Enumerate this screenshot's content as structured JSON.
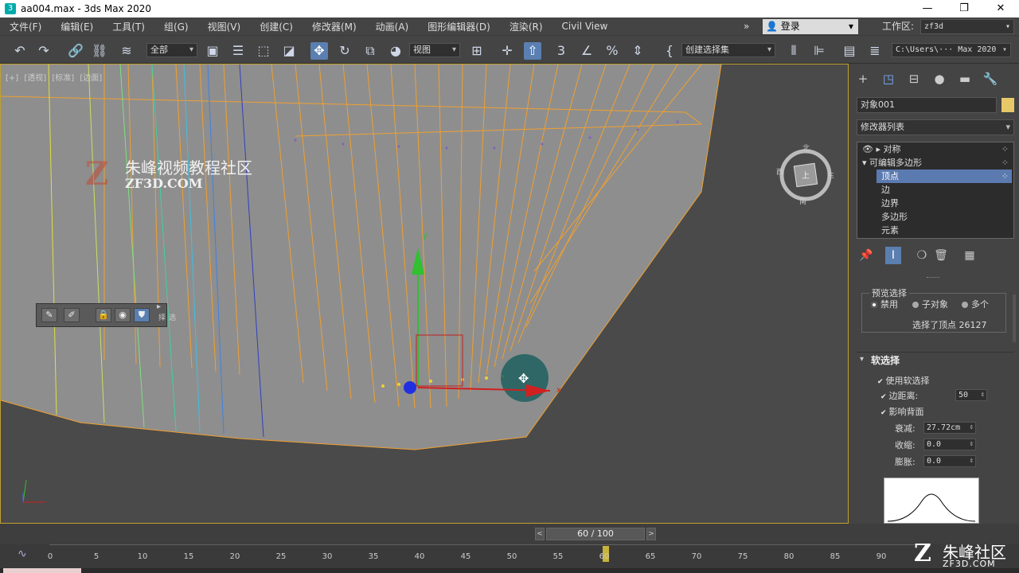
{
  "titlebar": {
    "app_icon": "3",
    "title": "aa004.max - 3ds Max 2020",
    "minimize": "—",
    "restore": "❐",
    "close": "✕"
  },
  "menubar": {
    "items": [
      "文件(F)",
      "编辑(E)",
      "工具(T)",
      "组(G)",
      "视图(V)",
      "创建(C)",
      "修改器(M)",
      "动画(A)",
      "图形编辑器(D)",
      "渲染(R)",
      "Civil View"
    ],
    "more": "»",
    "login": "登录",
    "workspace_label": "工作区:",
    "workspace_value": "zf3d"
  },
  "toolbar": {
    "selection_filter": "全部",
    "reference_coord": "视图",
    "named_selection": "创建选择集",
    "project_path": "C:\\Users\\··· Max 2020"
  },
  "viewport": {
    "label_plus": "[+]",
    "label_view": "[透视]",
    "label_shading1": "[标准]",
    "label_shading2": "[边面]",
    "watermark_cn": "朱峰视频教程社区",
    "watermark_en": "ZF3D.COM",
    "watermark_logo": "Z",
    "viewcube_n": "北",
    "viewcube_e": "东",
    "viewcube_s": "南",
    "viewcube_w": "西",
    "viewcube_face": "上",
    "gizmo_x": "x",
    "gizmo_y": "y"
  },
  "floating_toolbar": {
    "collapse": "▸",
    "side_label": "选择"
  },
  "command_panel": {
    "object_name": "对象001",
    "modifier_list": "修改器列表",
    "stack": [
      {
        "label": "对称",
        "type": "modifier"
      },
      {
        "label": "可编辑多边形",
        "type": "base"
      },
      {
        "label": "顶点",
        "type": "sub",
        "selected": true
      },
      {
        "label": "边",
        "type": "sub"
      },
      {
        "label": "边界",
        "type": "sub"
      },
      {
        "label": "多边形",
        "type": "sub"
      },
      {
        "label": "元素",
        "type": "sub"
      }
    ],
    "preview_selection": {
      "title": "预览选择",
      "options": [
        "禁用",
        "子对象",
        "多个"
      ],
      "selected": "禁用",
      "selection_text": "选择了顶点 26127"
    },
    "soft_selection": {
      "title": "软选择",
      "use_soft": "使用软选择",
      "edge_distance": "边距离:",
      "edge_distance_value": "50",
      "affect_backfacing": "影响背面",
      "falloff": "衰减:",
      "falloff_value": "27.72cm",
      "pinch": "收缩:",
      "pinch_value": "0.0",
      "bubble": "膨胀:",
      "bubble_value": "0.0"
    }
  },
  "time_slider": {
    "frame": "60 / 100",
    "prev": "<",
    "next": ">"
  },
  "trackbar": {
    "ticks": [
      "0",
      "5",
      "10",
      "15",
      "20",
      "25",
      "30",
      "35",
      "40",
      "45",
      "50",
      "55",
      "60",
      "65",
      "70",
      "75",
      "80",
      "85",
      "90"
    ]
  },
  "watermark_bottom": {
    "cn": "朱峰社区",
    "en": "ZF3D.COM",
    "logo": "Z"
  },
  "colors": {
    "accent": "#5a7fb0",
    "mesh_wire": "#f0a030",
    "viewport_border": "#c0a030"
  }
}
